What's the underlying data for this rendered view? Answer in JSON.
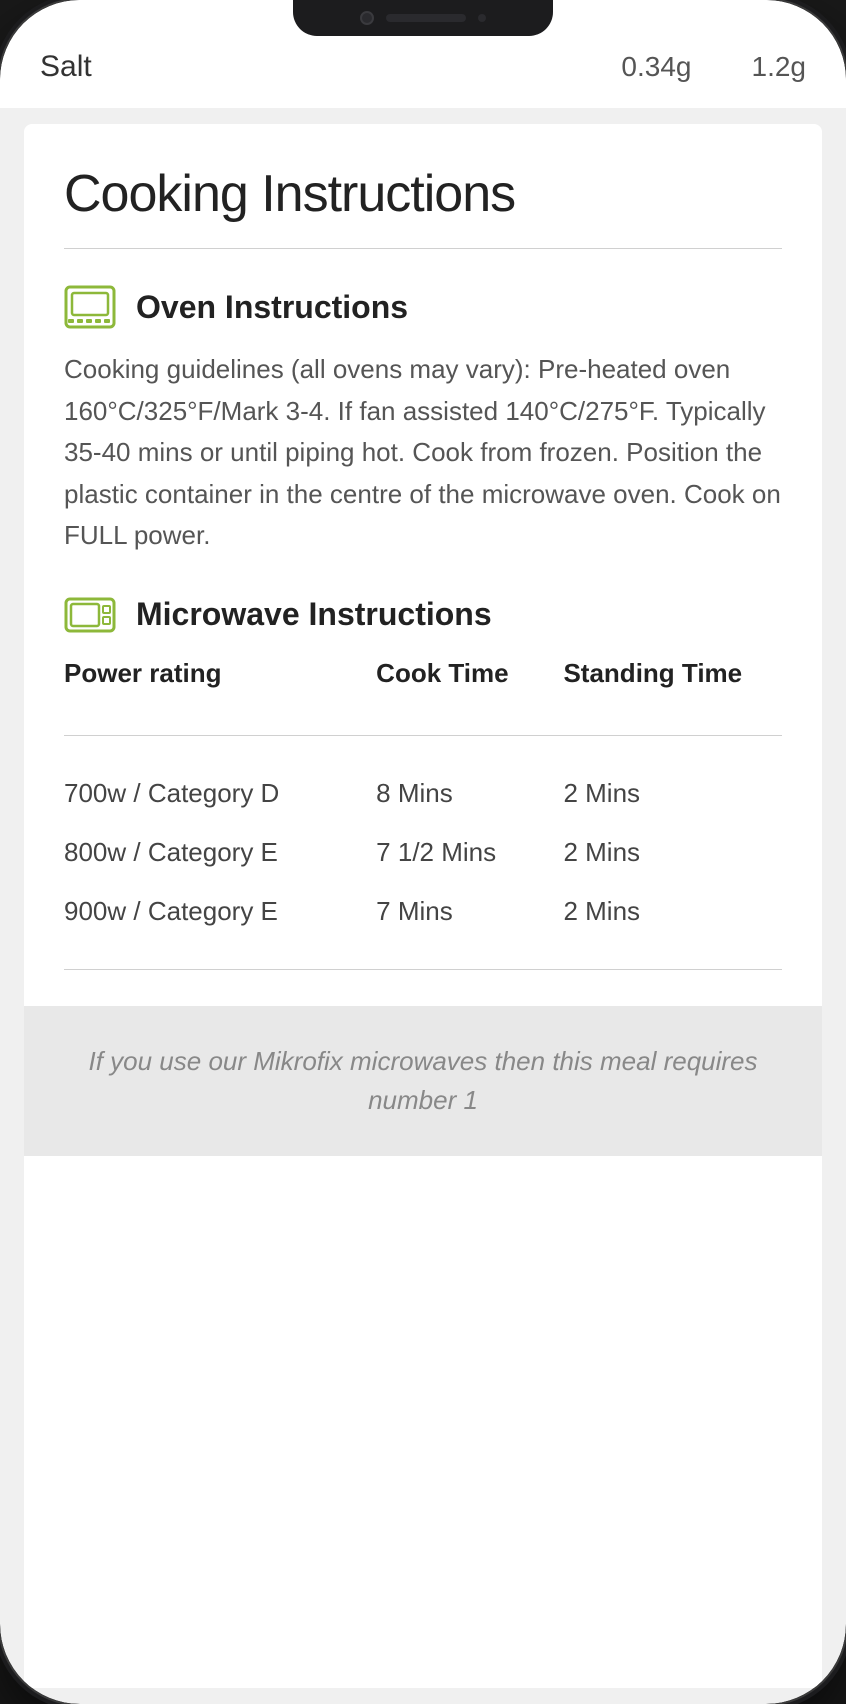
{
  "phone": {
    "notch": true
  },
  "top_partial": {
    "label": "Salt",
    "val1": "0.34g",
    "val2": "1.2g"
  },
  "cooking_instructions": {
    "title": "Cooking Instructions",
    "oven": {
      "heading": "Oven Instructions",
      "text": "Cooking guidelines (all ovens may vary): Pre-heated oven 160°C/325°F/Mark 3-4. If fan assisted 140°C/275°F. Typically 35-40 mins or until piping hot. Cook from frozen. Position the plastic container in the centre of the microwave oven. Cook on FULL power."
    },
    "microwave": {
      "heading": "Microwave Instructions",
      "table": {
        "headers": {
          "power_rating": "Power rating",
          "cook_time": "Cook Time",
          "standing_time": "Standing Time"
        },
        "rows": [
          {
            "power": "700w / Category D",
            "cook": "8 Mins",
            "standing": "2 Mins"
          },
          {
            "power": "800w / Category E",
            "cook": "7 1/2 Mins",
            "standing": "2 Mins"
          },
          {
            "power": "900w / Category E",
            "cook": "7 Mins",
            "standing": "2 Mins"
          }
        ]
      }
    },
    "footer_note": "If you use our Mikrofix microwaves then this meal requires number 1"
  },
  "colors": {
    "accent_green": "#8db83a",
    "divider": "#d0d0d0",
    "text_dark": "#222222",
    "text_body": "#555555",
    "footer_bg": "#e8e8e8",
    "footer_text": "#888888"
  }
}
